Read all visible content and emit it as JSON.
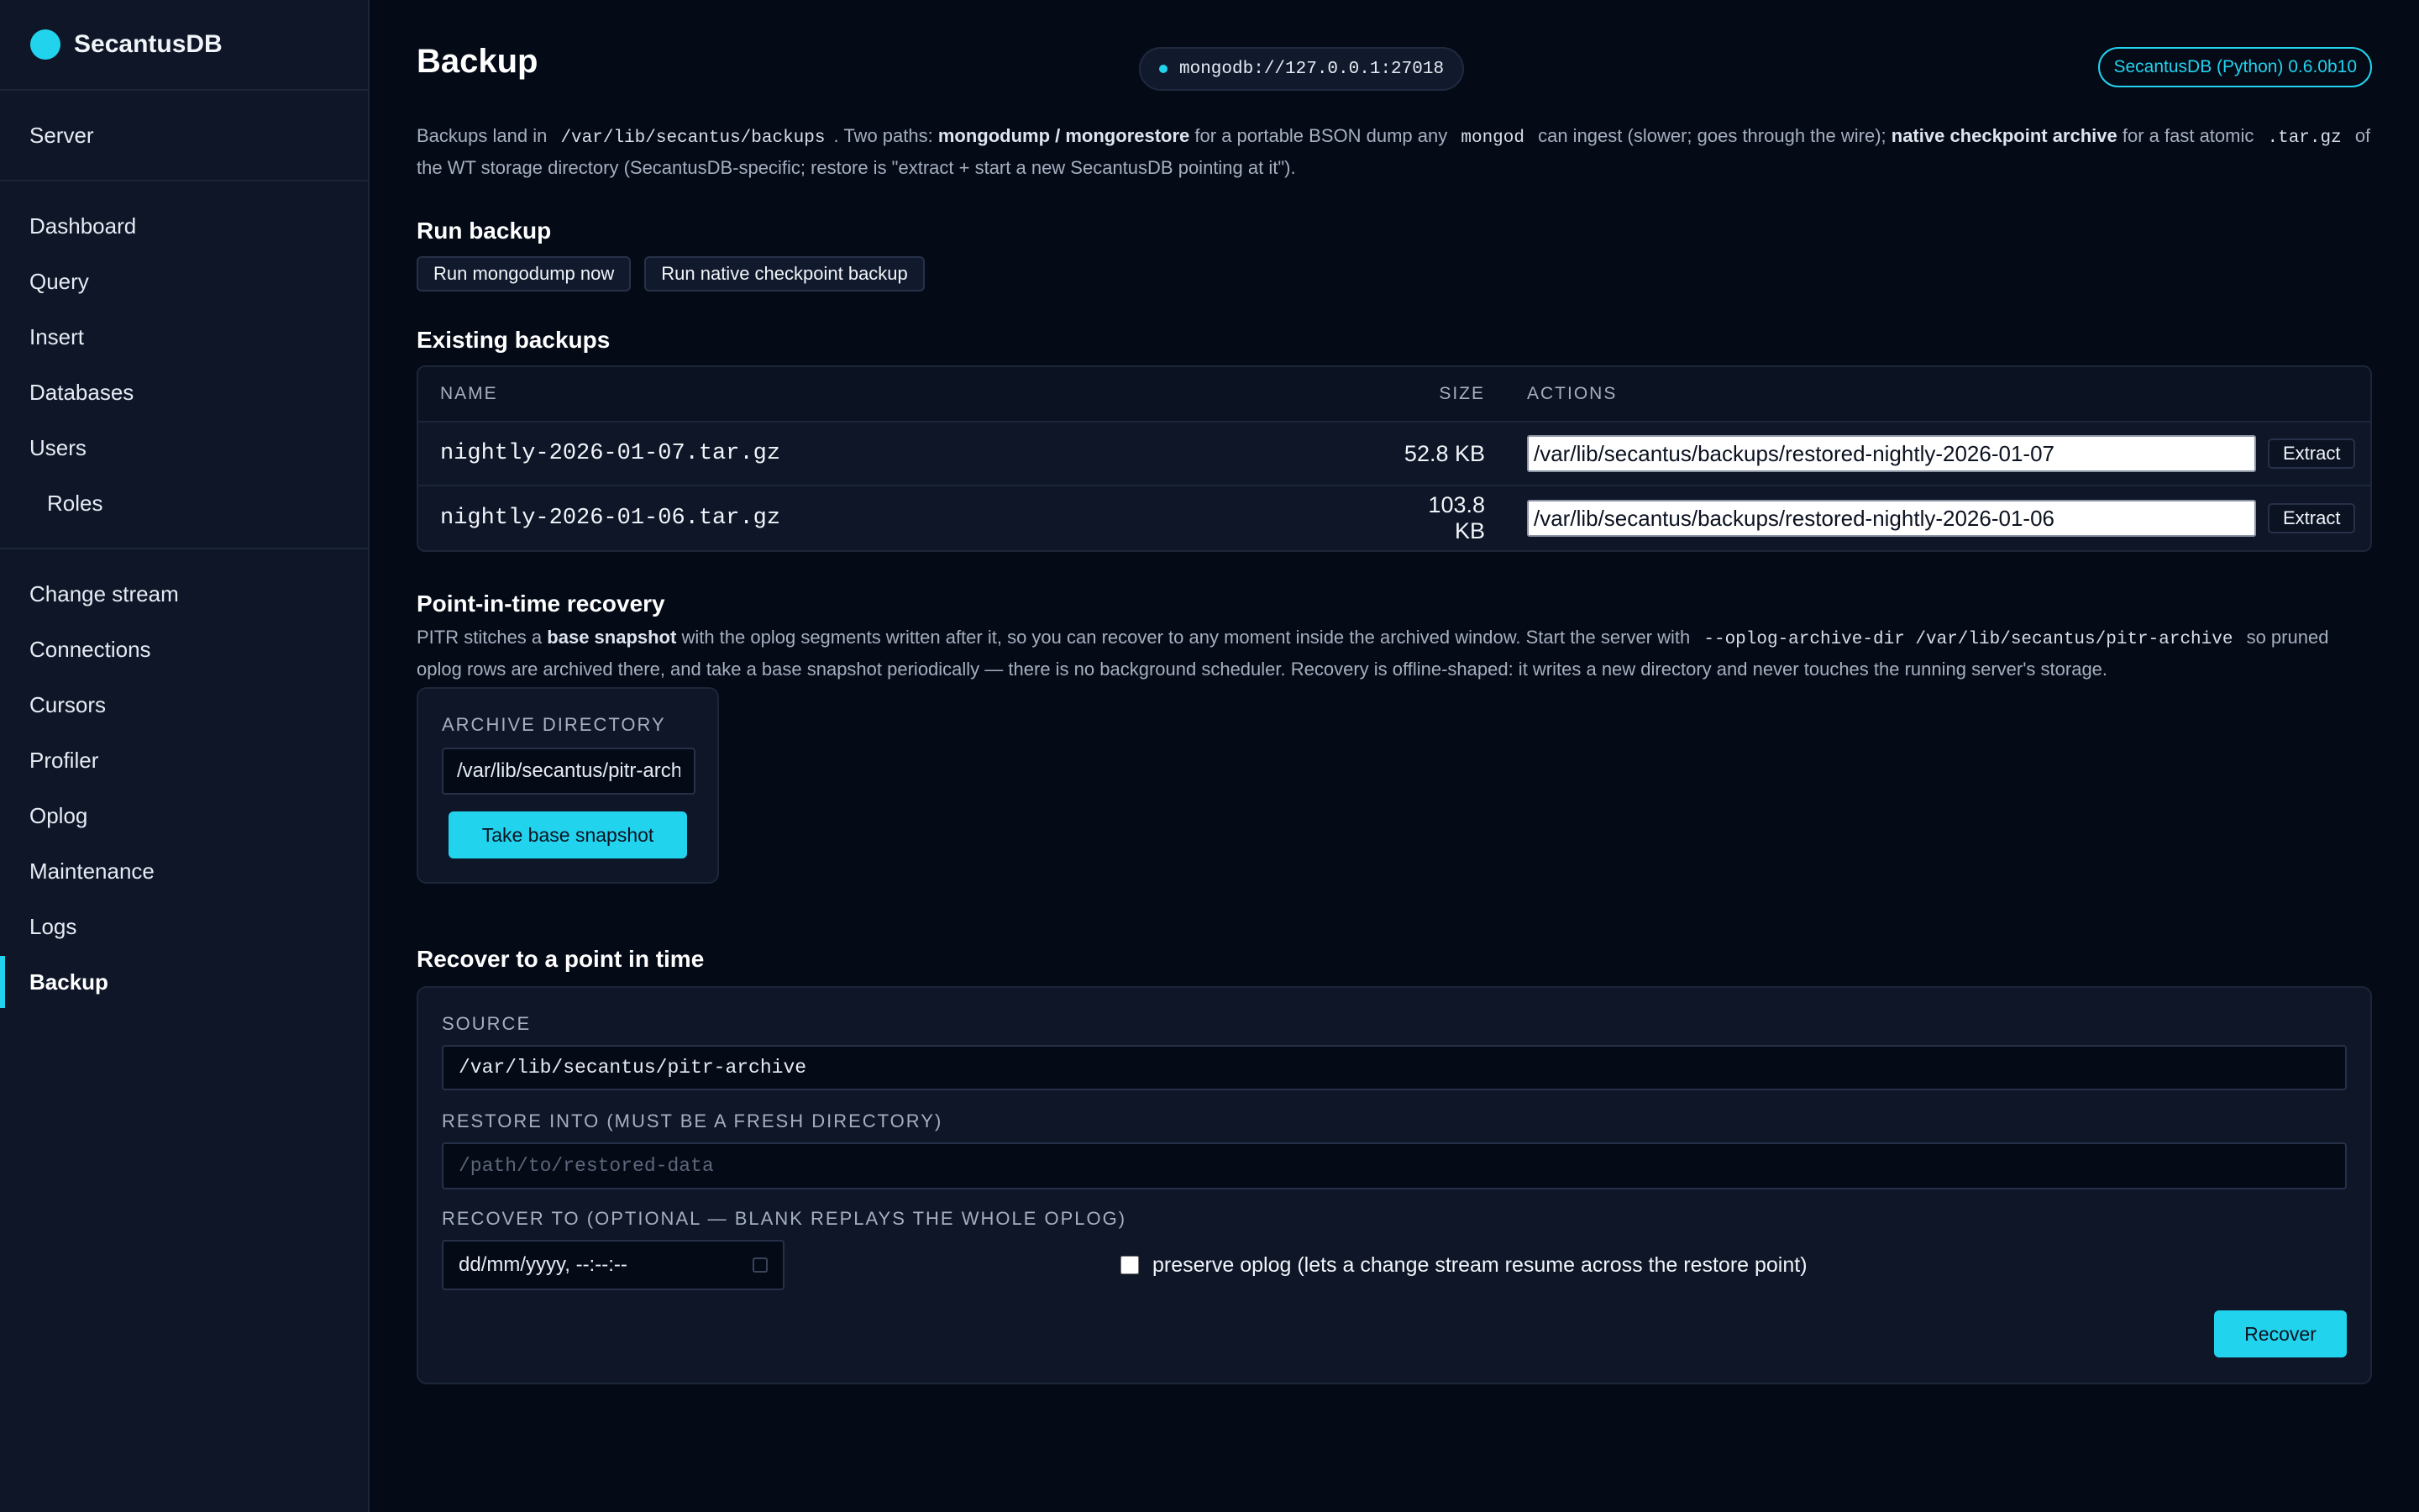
{
  "brand": {
    "name": "SecantusDB",
    "accent": "#22d3ee"
  },
  "sidebar": {
    "group1": [
      "Server"
    ],
    "group2": [
      "Dashboard",
      "Query",
      "Insert",
      "Databases",
      "Users",
      "Roles"
    ],
    "group3": [
      "Change stream",
      "Connections",
      "Cursors",
      "Profiler",
      "Oplog",
      "Maintenance",
      "Logs",
      "Backup"
    ],
    "active": "Backup"
  },
  "header": {
    "title": "Backup",
    "connection": "mongodb://127.0.0.1:27018",
    "version": "SecantusDB (Python) 0.6.0b10"
  },
  "intro": {
    "t1": "Backups land in ",
    "path": "/var/lib/secantus/backups",
    "t2": ". Two paths: ",
    "b1": "mongodump / mongorestore",
    "t3": " for a portable BSON dump any ",
    "mongod": "mongod",
    "t4": " can ingest (slower; goes through the wire); ",
    "b2": "native checkpoint archive",
    "t5": " for a fast atomic ",
    "targz": ".tar.gz",
    "t6": " of the WT storage directory (SecantusDB-specific; restore is \"extract + start a new SecantusDB pointing at it\")."
  },
  "run_backup": {
    "title": "Run backup",
    "mongodump_button": "Run mongodump now",
    "native_button": "Run native checkpoint backup"
  },
  "existing": {
    "title": "Existing backups",
    "columns": {
      "name": "NAME",
      "size": "SIZE",
      "actions": "ACTIONS"
    },
    "rows": [
      {
        "name": "nightly-2026-01-07.tar.gz",
        "size": "52.8 KB",
        "target": "/var/lib/secantus/backups/restored-nightly-2026-01-07",
        "action": "Extract"
      },
      {
        "name": "nightly-2026-01-06.tar.gz",
        "size": "103.8 KB",
        "target": "/var/lib/secantus/backups/restored-nightly-2026-01-06",
        "action": "Extract"
      }
    ]
  },
  "pitr": {
    "title": "Point-in-time recovery",
    "t1": "PITR stitches a ",
    "b1": "base snapshot",
    "t2": " with the oplog segments written after it, so you can recover to any moment inside the archived window. Start the server with ",
    "flag": "--oplog-archive-dir /var/lib/secantus/pitr-archive",
    "t3": " so pruned oplog rows are archived there, and take a base snapshot periodically — there is no background scheduler. Recovery is offline-shaped: it writes a new directory and never touches the running server's storage.",
    "archive_label": "ARCHIVE DIRECTORY",
    "archive_value": "/var/lib/secantus/pitr-archive",
    "snapshot_button": "Take base snapshot"
  },
  "recover": {
    "title": "Recover to a point in time",
    "source_label": "SOURCE",
    "source_value": "/var/lib/secantus/pitr-archive",
    "into_label": "RESTORE INTO (MUST BE A FRESH DIRECTORY)",
    "into_placeholder": "/path/to/restored-data",
    "to_label": "RECOVER TO (OPTIONAL — BLANK REPLAYS THE WHOLE OPLOG)",
    "to_placeholder": "dd/mm/yyyy, --:--:--",
    "preserve_label": "preserve oplog (lets a change stream resume across the restore point)",
    "recover_button": "Recover"
  }
}
